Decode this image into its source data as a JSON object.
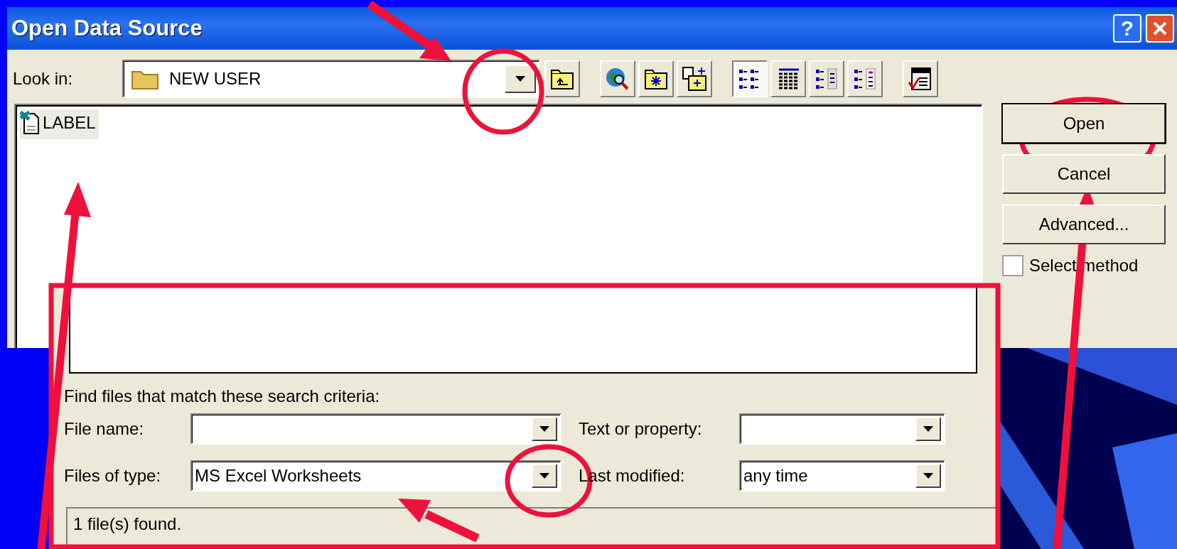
{
  "window": {
    "title": "Open Data Source",
    "help_button": "?"
  },
  "look_in": {
    "label": "Look in:",
    "value": "NEW USER"
  },
  "views": [
    {
      "kind": "list",
      "selected": true
    },
    {
      "kind": "details",
      "selected": false
    },
    {
      "kind": "properties",
      "selected": false
    },
    {
      "kind": "preview",
      "selected": false
    }
  ],
  "files": [
    {
      "name": "LABEL",
      "selected": true
    }
  ],
  "buttons": [
    {
      "label": "Open",
      "default": true
    },
    {
      "label": "Cancel",
      "default": false
    },
    {
      "label": "Advanced...",
      "default": false
    }
  ],
  "select_method": {
    "label": "Select method",
    "checked": false
  },
  "search": {
    "heading": "Find files that match these search criteria:",
    "fields": [
      {
        "label": "File name:"
      },
      {
        "label": "Text or property:"
      },
      {
        "label": "Files of type:",
        "value": "MS Excel Worksheets"
      },
      {
        "label": "Last modified:",
        "value": "any time"
      }
    ]
  },
  "status": "1 file(s) found."
}
